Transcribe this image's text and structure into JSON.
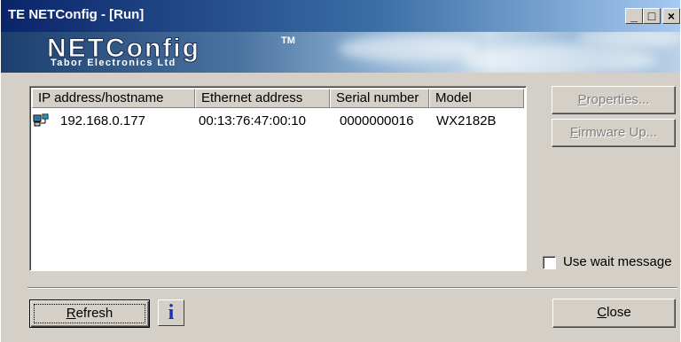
{
  "window": {
    "title": "TE NETConfig - [Run]"
  },
  "titlebar_buttons": {
    "minimize": "_",
    "maximize": "□",
    "close": "×"
  },
  "banner": {
    "logo": "NETConfig",
    "tm": "TM",
    "subtitle": "Tabor Electronics Ltd"
  },
  "device_list": {
    "columns": [
      "IP address/hostname",
      "Ethernet address",
      "Serial number",
      "Model"
    ],
    "rows": [
      {
        "icon": "network-computer-icon",
        "ip": "192.168.0.177",
        "ethernet": "00:13:76:47:00:10",
        "serial": "0000000016",
        "model": "WX2182B"
      }
    ]
  },
  "buttons": {
    "properties": {
      "accel": "P",
      "rest": "roperties..."
    },
    "firmware": {
      "accel": "F",
      "rest": "irmware Up..."
    },
    "refresh": {
      "accel": "R",
      "rest": "efresh"
    },
    "close": {
      "accel": "C",
      "rest": "lose"
    },
    "info_icon": "i"
  },
  "options": {
    "use_wait_message": {
      "label": "Use wait message",
      "checked": false
    }
  },
  "colors": {
    "title_gradient_start": "#0a246a",
    "title_gradient_end": "#a6caf0",
    "face": "#d4d0c8",
    "disabled_text": "#808080",
    "info_blue": "#1a2fb8"
  }
}
